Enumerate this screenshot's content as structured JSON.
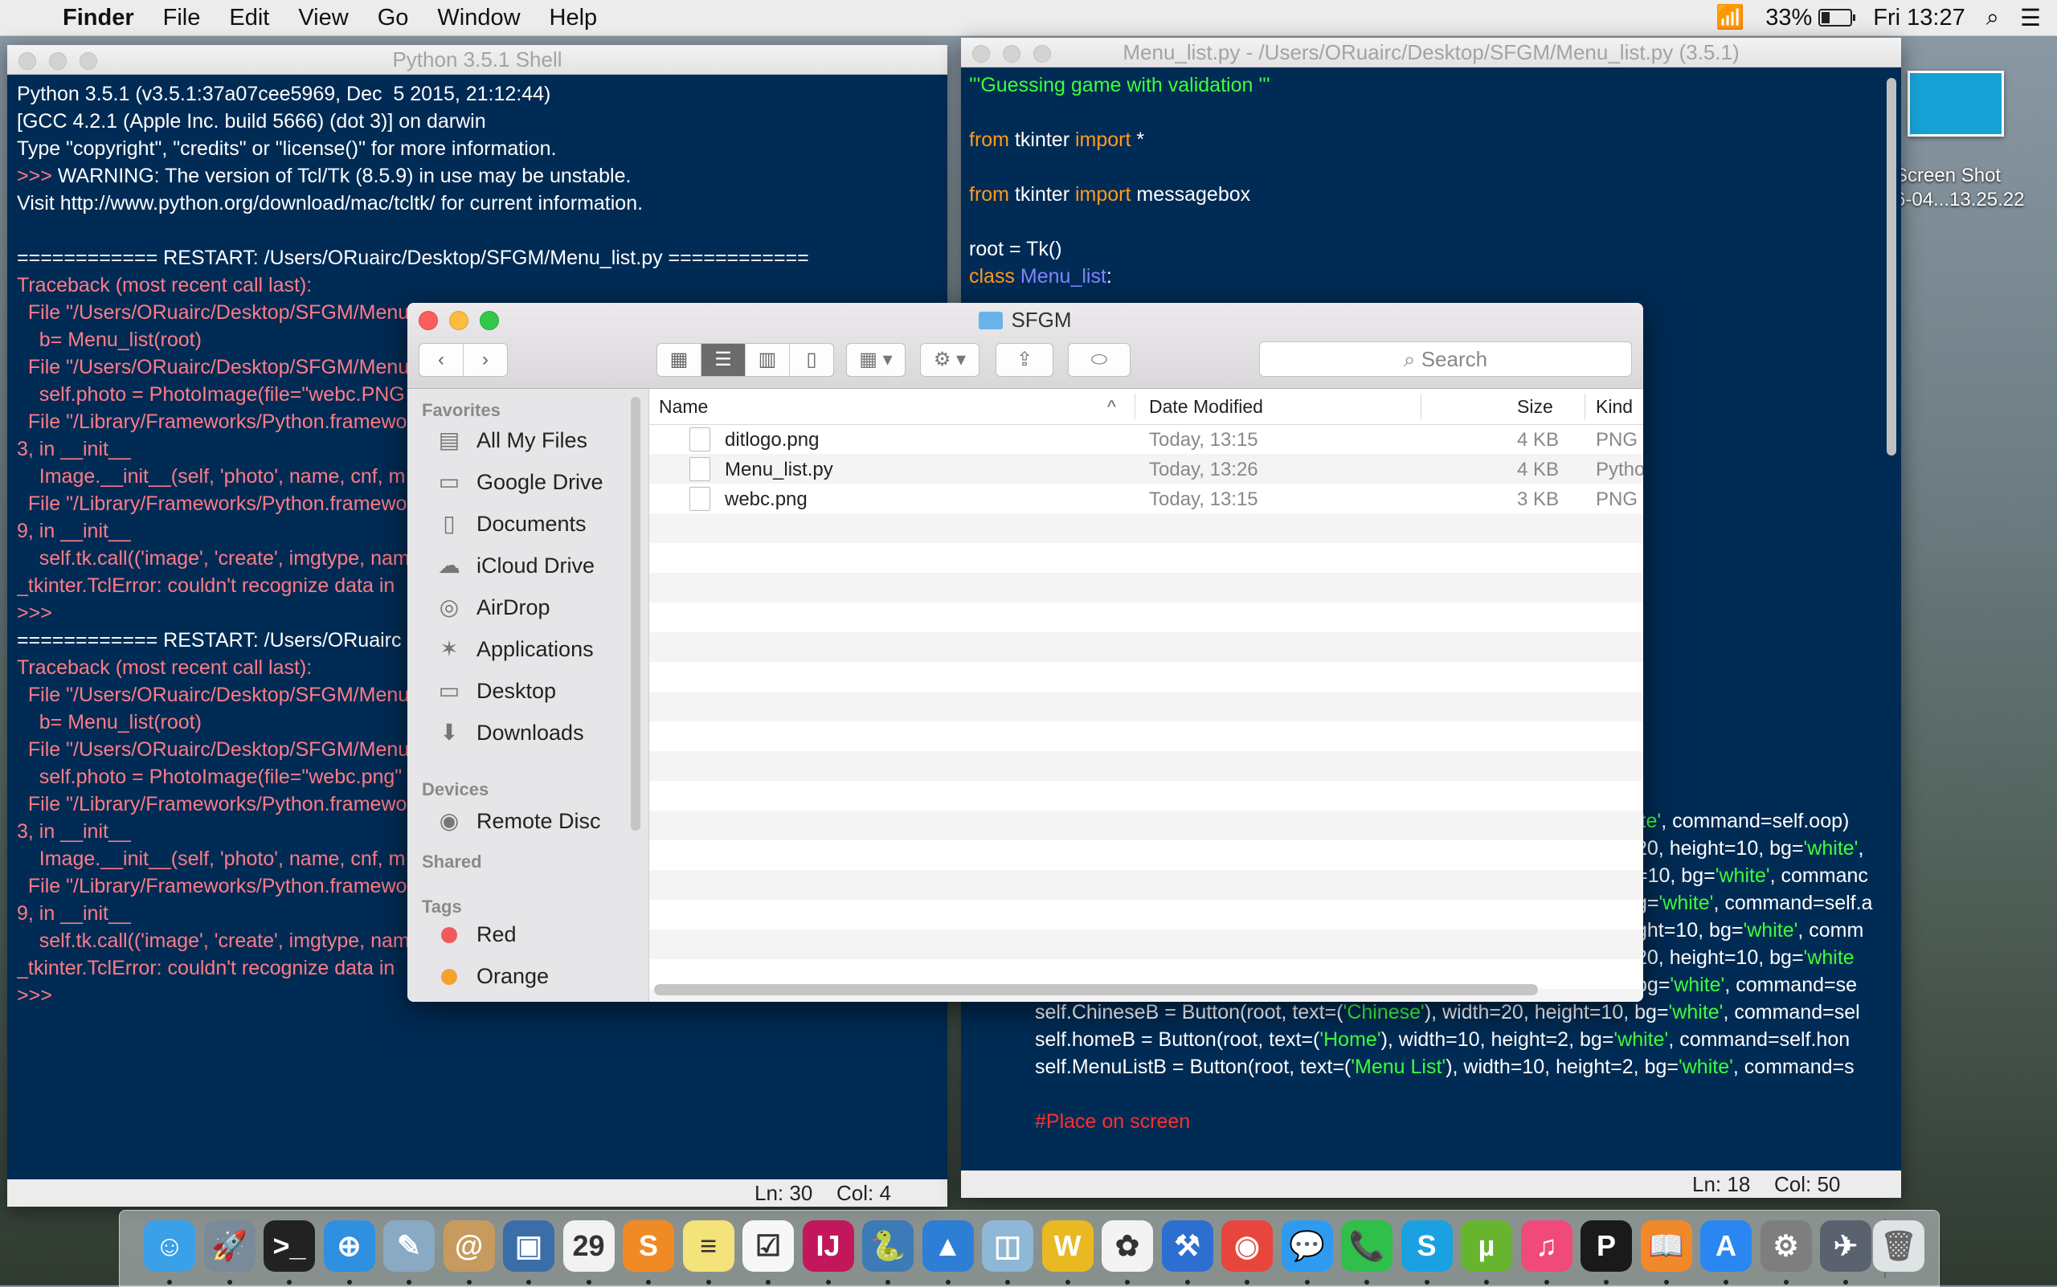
{
  "menubar": {
    "app": "Finder",
    "items": [
      "File",
      "Edit",
      "View",
      "Go",
      "Window",
      "Help"
    ],
    "battery": "33%",
    "clock": "Fri 13:27"
  },
  "shell": {
    "title": "Python 3.5.1 Shell",
    "lines": [
      {
        "t": "Python 3.5.1 (v3.5.1:37a07cee5969, Dec  5 2015, 21:12:44)",
        "c": ""
      },
      {
        "t": "[GCC 4.2.1 (Apple Inc. build 5666) (dot 3)] on darwin",
        "c": ""
      },
      {
        "t": "Type \"copyright\", \"credits\" or \"license()\" for more information.",
        "c": ""
      },
      {
        "t": ">>> WARNING: The version of Tcl/Tk (8.5.9) in use may be unstable.",
        "c": "mixprompt"
      },
      {
        "t": "Visit http://www.python.org/download/mac/tcltk/ for current information.",
        "c": ""
      },
      {
        "t": "",
        "c": ""
      },
      {
        "t": "============ RESTART: /Users/ORuairc/Desktop/SFGM/Menu_list.py ============",
        "c": ""
      },
      {
        "t": "Traceback (most recent call last):",
        "c": "err"
      },
      {
        "t": "  File \"/Users/ORuairc/Desktop/SFGM/Menu_",
        "c": "err"
      },
      {
        "t": "    b= Menu_list(root)",
        "c": "err"
      },
      {
        "t": "  File \"/Users/ORuairc/Desktop/SFGM/Menu_",
        "c": "err"
      },
      {
        "t": "    self.photo = PhotoImage(file=\"webc.PNG",
        "c": "err"
      },
      {
        "t": "  File \"/Library/Frameworks/Python.framewo",
        "c": "err"
      },
      {
        "t": "3, in __init__",
        "c": "err"
      },
      {
        "t": "    Image.__init__(self, 'photo', name, cnf, m",
        "c": "err"
      },
      {
        "t": "  File \"/Library/Frameworks/Python.framewo",
        "c": "err"
      },
      {
        "t": "9, in __init__",
        "c": "err"
      },
      {
        "t": "    self.tk.call(('image', 'create', imgtype, nam",
        "c": "err"
      },
      {
        "t": "_tkinter.TclError: couldn't recognize data in",
        "c": "err"
      },
      {
        "t": ">>> ",
        "c": "err"
      },
      {
        "t": "============ RESTART: /Users/ORuairc",
        "c": ""
      },
      {
        "t": "Traceback (most recent call last):",
        "c": "err"
      },
      {
        "t": "  File \"/Users/ORuairc/Desktop/SFGM/Menu_",
        "c": "err"
      },
      {
        "t": "    b= Menu_list(root)",
        "c": "err"
      },
      {
        "t": "  File \"/Users/ORuairc/Desktop/SFGM/Menu_",
        "c": "err"
      },
      {
        "t": "    self.photo = PhotoImage(file=\"webc.png\"",
        "c": "err"
      },
      {
        "t": "  File \"/Library/Frameworks/Python.framewo",
        "c": "err"
      },
      {
        "t": "3, in __init__",
        "c": "err"
      },
      {
        "t": "    Image.__init__(self, 'photo', name, cnf, m",
        "c": "err"
      },
      {
        "t": "  File \"/Library/Frameworks/Python.framewo",
        "c": "err"
      },
      {
        "t": "9, in __init__",
        "c": "err"
      },
      {
        "t": "    self.tk.call(('image', 'create', imgtype, nam",
        "c": "err"
      },
      {
        "t": "_tkinter.TclError: couldn't recognize data in",
        "c": "err"
      },
      {
        "t": ">>> ",
        "c": "err"
      }
    ],
    "status_ln": "Ln: 30",
    "status_col": "Col: 4"
  },
  "editor": {
    "title": "Menu_list.py - /Users/ORuairc/Desktop/SFGM/Menu_list.py (3.5.1)",
    "status_ln": "Ln: 18",
    "status_col": "Col: 50",
    "top_lines": [
      [
        {
          "t": "'''Guessing game with validation '''",
          "c": "str"
        }
      ],
      [],
      [
        {
          "t": "from",
          "c": "kw"
        },
        {
          "t": " tkinter ",
          "c": ""
        },
        {
          "t": "import",
          "c": "kw"
        },
        {
          "t": " *",
          "c": ""
        }
      ],
      [],
      [
        {
          "t": "from",
          "c": "kw"
        },
        {
          "t": " tkinter ",
          "c": ""
        },
        {
          "t": "import",
          "c": "kw"
        },
        {
          "t": " messagebox",
          "c": ""
        }
      ],
      [],
      [
        {
          "t": "root = Tk()",
          "c": ""
        }
      ],
      [
        {
          "t": "class",
          "c": "kw"
        },
        {
          "t": " ",
          "c": ""
        },
        {
          "t": "Menu_list",
          "c": "cls"
        },
        {
          "t": ":",
          "c": ""
        }
      ]
    ],
    "right_lines": [
      [
        {
          "t": "ite'",
          "c": "str"
        },
        {
          "t": ", command=self.oop)",
          "c": ""
        }
      ],
      [
        {
          "t": "20, height=10, bg=",
          "c": ""
        },
        {
          "t": "'white'",
          "c": "str"
        },
        {
          "t": ",",
          "c": ""
        }
      ],
      [
        {
          "t": "=10, bg=",
          "c": ""
        },
        {
          "t": "'white'",
          "c": "str"
        },
        {
          "t": ", commanc",
          "c": ""
        }
      ],
      [
        {
          "t": "g=",
          "c": ""
        },
        {
          "t": "'white'",
          "c": "str"
        },
        {
          "t": ", command=self.a",
          "c": ""
        }
      ],
      [
        {
          "t": "ght=10, bg=",
          "c": ""
        },
        {
          "t": "'white'",
          "c": "str"
        },
        {
          "t": ", comm",
          "c": ""
        }
      ],
      [
        {
          "t": "20, height=10, bg=",
          "c": ""
        },
        {
          "t": "'white",
          "c": "str"
        }
      ],
      [
        {
          "t": "bg=",
          "c": ""
        },
        {
          "t": "'white'",
          "c": "str"
        },
        {
          "t": ", command=se",
          "c": ""
        }
      ]
    ],
    "bottom_lines": [
      [
        {
          "t": "self.ChineseB = Button(root, text=(",
          "c": ""
        },
        {
          "t": "'Chinese'",
          "c": "str"
        },
        {
          "t": "), width=20, height=10, bg=",
          "c": ""
        },
        {
          "t": "'white'",
          "c": "str"
        },
        {
          "t": ", command=sel",
          "c": ""
        }
      ],
      [
        {
          "t": "self.homeB = Button(root, text=(",
          "c": ""
        },
        {
          "t": "'Home'",
          "c": "str"
        },
        {
          "t": "), width=10, height=2, bg=",
          "c": ""
        },
        {
          "t": "'white'",
          "c": "str"
        },
        {
          "t": ", command=self.hon",
          "c": ""
        }
      ],
      [
        {
          "t": "self.MenuListB = Button(root, text=(",
          "c": ""
        },
        {
          "t": "'Menu List'",
          "c": "str"
        },
        {
          "t": "), width=10, height=2, bg=",
          "c": ""
        },
        {
          "t": "'white'",
          "c": "str"
        },
        {
          "t": ", command=s",
          "c": ""
        }
      ],
      [],
      [
        {
          "t": "#Place on screen",
          "c": "red"
        }
      ]
    ]
  },
  "finder": {
    "title": "SFGM",
    "search_placeholder": "Search",
    "sidebar": {
      "favorites_header": "Favorites",
      "favorites": [
        {
          "label": "All My Files",
          "icon": "all-files-icon",
          "glyph": "▤"
        },
        {
          "label": "Google Drive",
          "icon": "folder-icon",
          "glyph": "▭"
        },
        {
          "label": "Documents",
          "icon": "documents-icon",
          "glyph": "▯"
        },
        {
          "label": "iCloud Drive",
          "icon": "cloud-icon",
          "glyph": "☁"
        },
        {
          "label": "AirDrop",
          "icon": "airdrop-icon",
          "glyph": "◎"
        },
        {
          "label": "Applications",
          "icon": "applications-icon",
          "glyph": "✶"
        },
        {
          "label": "Desktop",
          "icon": "desktop-icon",
          "glyph": "▭"
        },
        {
          "label": "Downloads",
          "icon": "downloads-icon",
          "glyph": "⬇"
        }
      ],
      "devices_header": "Devices",
      "devices": [
        {
          "label": "Remote Disc",
          "icon": "disc-icon",
          "glyph": "◉"
        }
      ],
      "shared_header": "Shared",
      "tags_header": "Tags",
      "tags": [
        {
          "label": "Red",
          "color": "#f05a5a"
        },
        {
          "label": "Orange",
          "color": "#f5a030"
        }
      ]
    },
    "columns": {
      "name": "Name",
      "date": "Date Modified",
      "size": "Size",
      "kind": "Kind"
    },
    "files": [
      {
        "name": "ditlogo.png",
        "date": "Today, 13:15",
        "size": "4 KB",
        "kind": "PNG"
      },
      {
        "name": "Menu_list.py",
        "date": "Today, 13:26",
        "size": "4 KB",
        "kind": "Pytho"
      },
      {
        "name": "webc.png",
        "date": "Today, 13:15",
        "size": "3 KB",
        "kind": "PNG"
      }
    ]
  },
  "desktop": {
    "screenshot_label_line1": "Screen Shot",
    "screenshot_label_line2": "6-04...13.25.22"
  },
  "dock": {
    "apps": [
      {
        "name": "finder",
        "color": "#3aa0e8",
        "glyph": "☺"
      },
      {
        "name": "launchpad",
        "color": "#7a8a99",
        "glyph": "🚀"
      },
      {
        "name": "terminal",
        "color": "#222222",
        "glyph": ">_"
      },
      {
        "name": "safari",
        "color": "#2f8fe0",
        "glyph": "⊕"
      },
      {
        "name": "preview",
        "color": "#8aa9c2",
        "glyph": "✎"
      },
      {
        "name": "contacts",
        "color": "#c79b5f",
        "glyph": "@"
      },
      {
        "name": "virtualbox",
        "color": "#3b6ea8",
        "glyph": "▣"
      },
      {
        "name": "calendar",
        "color": "#f2f2f2",
        "glyph": "29"
      },
      {
        "name": "sublime",
        "color": "#f08a24",
        "glyph": "S"
      },
      {
        "name": "notes",
        "color": "#f4e27a",
        "glyph": "≡"
      },
      {
        "name": "reminders",
        "color": "#f7f7f7",
        "glyph": "☑"
      },
      {
        "name": "intellij",
        "color": "#c2185b",
        "glyph": "IJ"
      },
      {
        "name": "python-launcher",
        "color": "#3d7ab8",
        "glyph": "🐍"
      },
      {
        "name": "keynote",
        "color": "#2d7fd6",
        "glyph": "▲"
      },
      {
        "name": "image-capture",
        "color": "#8fb7d6",
        "glyph": "◫"
      },
      {
        "name": "app-yellow",
        "color": "#e9b923",
        "glyph": "W"
      },
      {
        "name": "photos",
        "color": "#f3f3f3",
        "glyph": "✿"
      },
      {
        "name": "xcode",
        "color": "#2c6fd1",
        "glyph": "⚒"
      },
      {
        "name": "chrome",
        "color": "#e8453c",
        "glyph": "◉"
      },
      {
        "name": "messages",
        "color": "#2f9bf0",
        "glyph": "💬"
      },
      {
        "name": "facetime",
        "color": "#2fbf4a",
        "glyph": "📞"
      },
      {
        "name": "skype",
        "color": "#1ba1e2",
        "glyph": "S"
      },
      {
        "name": "utorrent",
        "color": "#67b52f",
        "glyph": "µ"
      },
      {
        "name": "itunes",
        "color": "#f04a7a",
        "glyph": "♫"
      },
      {
        "name": "pycharm-p",
        "color": "#1a1a1a",
        "glyph": "P"
      },
      {
        "name": "ibooks",
        "color": "#f0892a",
        "glyph": "📖"
      },
      {
        "name": "app-store",
        "color": "#2a86f0",
        "glyph": "A"
      },
      {
        "name": "system-preferences",
        "color": "#7e7e7e",
        "glyph": "⚙"
      },
      {
        "name": "rocket-app",
        "color": "#5a6270",
        "glyph": "✈"
      }
    ],
    "trash": {
      "name": "trash",
      "color": "#dfe3e6",
      "glyph": "🗑"
    }
  }
}
